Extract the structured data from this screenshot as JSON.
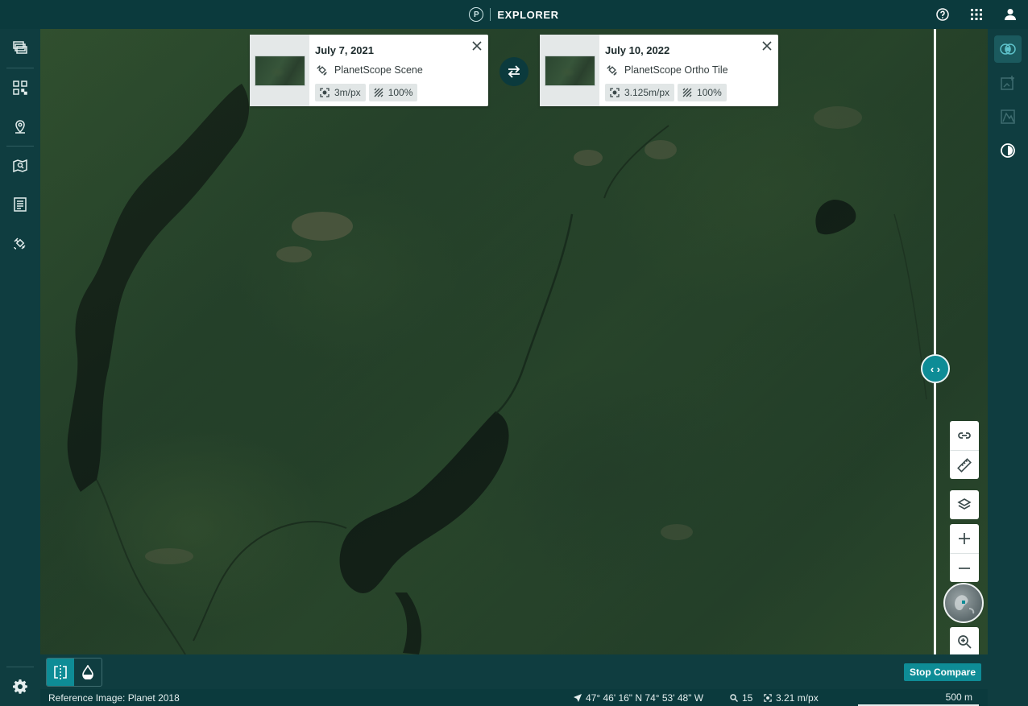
{
  "app": {
    "brand_letter": "P",
    "title": "EXPLORER"
  },
  "top_actions": [
    "help-icon",
    "apps-grid-icon",
    "user-icon"
  ],
  "left_sidebar": {
    "items": [
      {
        "name": "sidebar-item-layers",
        "icon": "stack-icon"
      },
      {
        "name": "sidebar-item-mosaics",
        "icon": "grid-qr-icon"
      },
      {
        "name": "sidebar-item-places",
        "icon": "map-pin-icon"
      },
      {
        "name": "sidebar-item-saved-searches",
        "icon": "map-search-icon"
      },
      {
        "name": "sidebar-item-orders",
        "icon": "list-doc-icon"
      },
      {
        "name": "sidebar-item-tasking",
        "icon": "satellite-icon"
      }
    ],
    "settings_icon": "gear-icon"
  },
  "right_sidebar": {
    "items": [
      {
        "name": "compare-tool",
        "icon": "compare-rings-icon",
        "active": true
      },
      {
        "name": "change-detection-tool",
        "icon": "image-plus-icon",
        "active": false
      },
      {
        "name": "elevation-tool",
        "icon": "terrain-icon",
        "active": false
      },
      {
        "name": "timelapse-tool",
        "icon": "clock-half-icon",
        "active": false
      }
    ]
  },
  "compare": {
    "left_card": {
      "date": "July 7, 2021",
      "product": "PlanetScope Scene",
      "resolution": "3m/px",
      "coverage": "100%"
    },
    "right_card": {
      "date": "July 10, 2022",
      "product": "PlanetScope Ortho Tile",
      "resolution": "3.125m/px",
      "coverage": "100%"
    },
    "handle_glyph": "‹ ›"
  },
  "map_controls": [
    "link-icon",
    "ruler-icon",
    "layers-icon",
    "plus-icon",
    "minus-icon",
    "globe-icon",
    "zoom-in-icon"
  ],
  "bottom_toolbar": {
    "modes": [
      {
        "name": "split-view-mode",
        "icon": "split-icon",
        "active": true
      },
      {
        "name": "swipe-opacity-mode",
        "icon": "droplet-icon",
        "active": false
      }
    ],
    "stop_compare_label": "Stop Compare"
  },
  "status": {
    "reference": "Reference Image: Planet 2018",
    "coordinates": "47° 46' 16\" N 74° 53' 48\" W",
    "zoom": "15",
    "resolution": "3.21 m/px",
    "scale": "500 m"
  },
  "colors": {
    "chrome": "#0f3d40",
    "topbar": "#0b3a3d",
    "accent": "#0e8c96",
    "map_forest": "#2a4a2c"
  }
}
